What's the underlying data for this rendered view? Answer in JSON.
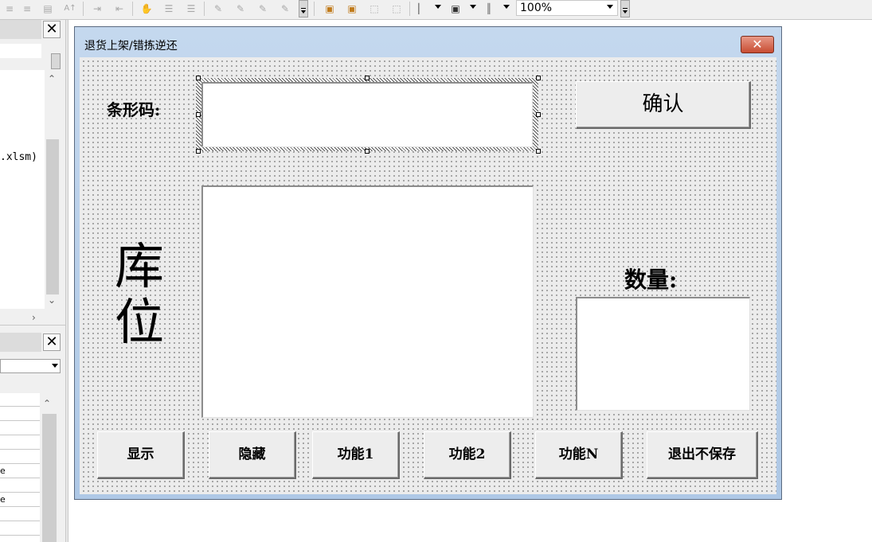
{
  "toolbar": {
    "zoom_value": "100%",
    "icons": [
      "align-icon",
      "align-icon",
      "align-icon",
      "font-size-icon",
      "indent-icon",
      "outdent-icon",
      "hand-icon",
      "list-icon",
      "list-icon",
      "draw-icon",
      "draw-icon",
      "draw-icon",
      "draw-icon",
      "bring-front-icon",
      "send-back-icon",
      "group-icon",
      "ungroup-icon",
      "align-left-icon",
      "center-icon",
      "size-icon"
    ]
  },
  "left_pane": {
    "project_file_text": ".xlsm)",
    "property_rows": [
      "",
      "",
      "",
      "",
      "",
      "e",
      "",
      "e",
      "",
      ""
    ]
  },
  "dialog": {
    "title": "退货上架/错拣逆还",
    "close_symbol": "✕",
    "barcode_label": "条形码:",
    "confirm_button": "确认",
    "location_label_1": "库",
    "location_label_2": "位",
    "quantity_label": "数量:",
    "buttons": {
      "show": "显示",
      "hide": "隐藏",
      "func1": "功能1",
      "func2": "功能2",
      "funcN": "功能N",
      "exit": "退出不保存"
    }
  }
}
